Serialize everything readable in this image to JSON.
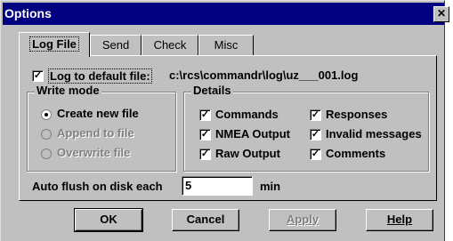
{
  "window": {
    "title": "Options",
    "close_glyph": "✕"
  },
  "tabs": [
    {
      "label": "Log File",
      "active": true
    },
    {
      "label": "Send",
      "active": false
    },
    {
      "label": "Check",
      "active": false
    },
    {
      "label": "Misc",
      "active": false
    }
  ],
  "log_file": {
    "log_to_default": {
      "label": "Log to default file:",
      "checked": true
    },
    "path": "c:\\rcs\\commandr\\log\\uz___001.log",
    "write_mode": {
      "title": "Write mode",
      "options": [
        {
          "label": "Create new file",
          "selected": true,
          "enabled": true
        },
        {
          "label": "Append to file",
          "selected": false,
          "enabled": false
        },
        {
          "label": "Overwrite file",
          "selected": false,
          "enabled": false
        }
      ]
    },
    "details": {
      "title": "Details",
      "items": [
        {
          "label": "Commands",
          "checked": true
        },
        {
          "label": "Responses",
          "checked": true
        },
        {
          "label": "NMEA Output",
          "checked": true
        },
        {
          "label": "Invalid messages",
          "checked": true
        },
        {
          "label": "Raw Output",
          "checked": true
        },
        {
          "label": "Comments",
          "checked": true
        }
      ]
    },
    "auto_flush": {
      "label": "Auto flush on disk each",
      "value": "5",
      "unit": "min"
    }
  },
  "buttons": {
    "ok": "OK",
    "cancel": "Cancel",
    "apply": "Apply",
    "help": "Help"
  },
  "check_glyph": "✓"
}
